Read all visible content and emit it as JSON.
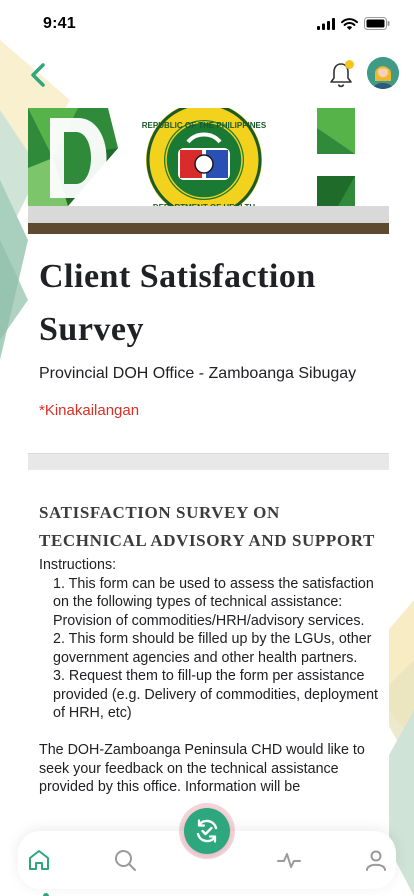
{
  "status_bar": {
    "time": "9:41"
  },
  "header": {
    "back_icon": "chevron-left-icon",
    "notification_icon": "bell-icon",
    "avatar": "user-avatar"
  },
  "form": {
    "banner_letters": "DOH",
    "seal_text_top": "REPUBLIC OF THE PHILIPPINES",
    "seal_text_bottom": "DEPARTMENT OF HEALTH",
    "title": "Client Satisfaction Survey",
    "subtitle": "Provincial DOH Office - Zamboanga Sibugay",
    "required_note": "*Kinakailangan",
    "section_heading": "SATISFACTION SURVEY ON TECHNICAL ADVISORY AND SUPPORT",
    "instructions_label": "Instructions:",
    "instruction_1": "1. This form can be used to assess the satisfaction on the following types of technical assistance: Provision of commodities/HRH/advisory services.",
    "instruction_2": "2. This form should be filled up by the LGUs, other government agencies and other health partners.",
    "instruction_3": "3. Request them to fill-up the form per assistance provided (e.g. Delivery of commodities, deployment of HRH, etc)",
    "feedback_paragraph": "The DOH-Zamboanga Peninsula CHD would like to seek your feedback on the technical assistance provided by this office. Information will be"
  },
  "bottom_nav": {
    "items": [
      "home-icon",
      "search-icon",
      "activity-icon",
      "profile-icon"
    ],
    "center_action": "check-refresh-icon",
    "active": "home"
  },
  "colors": {
    "accent_green": "#2ea77f",
    "required_red": "#d93025",
    "notification_dot": "#f5c518",
    "banner_brown": "#5d4a2f"
  }
}
